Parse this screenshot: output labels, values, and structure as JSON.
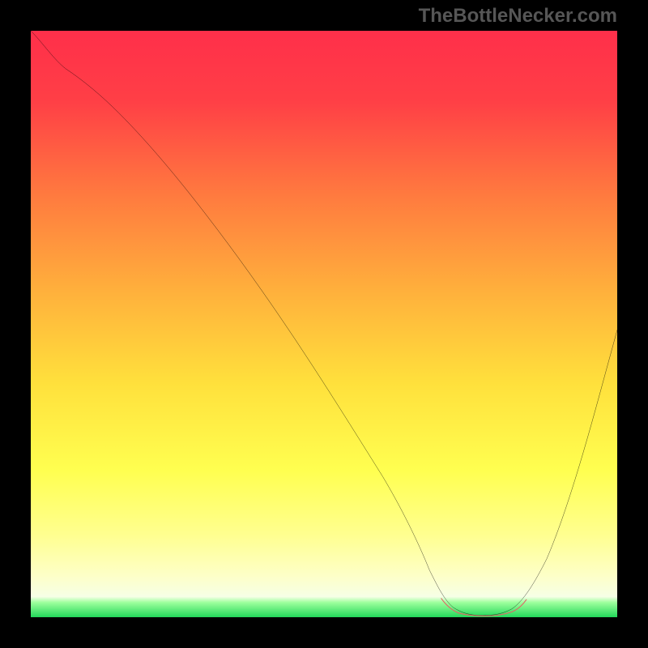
{
  "watermark": "TheBottleNecker.com",
  "colors": {
    "bg_black": "#000000",
    "grad_top": "#ff2f4a",
    "grad_mid_upper": "#ff8243",
    "grad_mid": "#ffd93f",
    "grad_lower": "#ffff66",
    "grad_pale": "#fcffb8",
    "grad_bottom": "#2dde5f",
    "curve_stroke": "#000000",
    "accent_segment": "#e06666"
  },
  "chart_data": {
    "type": "line",
    "title": "",
    "xlabel": "",
    "ylabel": "",
    "xlim": [
      0,
      100
    ],
    "ylim": [
      0,
      100
    ],
    "series": [
      {
        "name": "bottleneck-curve",
        "x": [
          0,
          3,
          6,
          10,
          15,
          20,
          25,
          30,
          35,
          40,
          45,
          50,
          55,
          60,
          65,
          68,
          72,
          76,
          80,
          84,
          88,
          92,
          96,
          100
        ],
        "values": [
          100,
          97,
          94,
          92,
          88,
          82,
          76,
          69,
          62,
          55,
          47,
          40,
          32,
          24,
          14,
          7,
          2,
          0,
          0,
          2,
          10,
          22,
          35,
          48
        ]
      },
      {
        "name": "optimal-range-highlight",
        "x": [
          70,
          72,
          74,
          76,
          78,
          80,
          82,
          84
        ],
        "values": [
          3,
          1.5,
          0.8,
          0.3,
          0.3,
          0.8,
          1.5,
          3
        ]
      }
    ],
    "annotations": []
  }
}
